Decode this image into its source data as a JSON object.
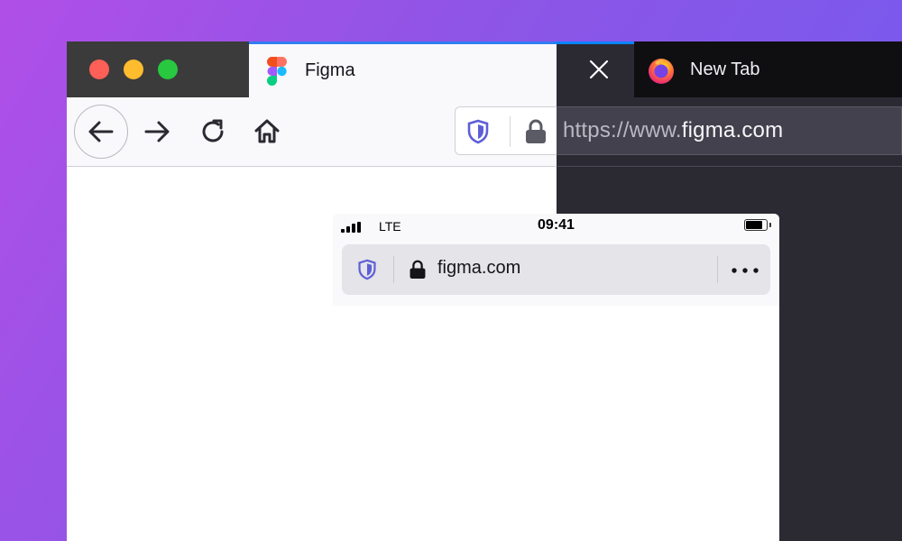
{
  "browser": {
    "tab_active": {
      "title": "Figma"
    },
    "tab_new": {
      "title": "New Tab"
    },
    "url": {
      "prefix": "https://www.",
      "domain": "figma.com"
    }
  },
  "mobile": {
    "status": {
      "carrier": "LTE",
      "time": "09:41"
    },
    "url": "figma.com"
  },
  "colors": {
    "accent": "#2f7ef2",
    "traffic_red": "#fe5f57",
    "traffic_yellow": "#febc2e",
    "traffic_green": "#28c840",
    "shield": "#5d5fd6"
  },
  "icons": [
    "back-arrow-icon",
    "forward-arrow-icon",
    "reload-icon",
    "home-icon",
    "shield-icon",
    "lock-icon",
    "close-icon",
    "figma-logo",
    "firefox-logo",
    "more-icon"
  ]
}
